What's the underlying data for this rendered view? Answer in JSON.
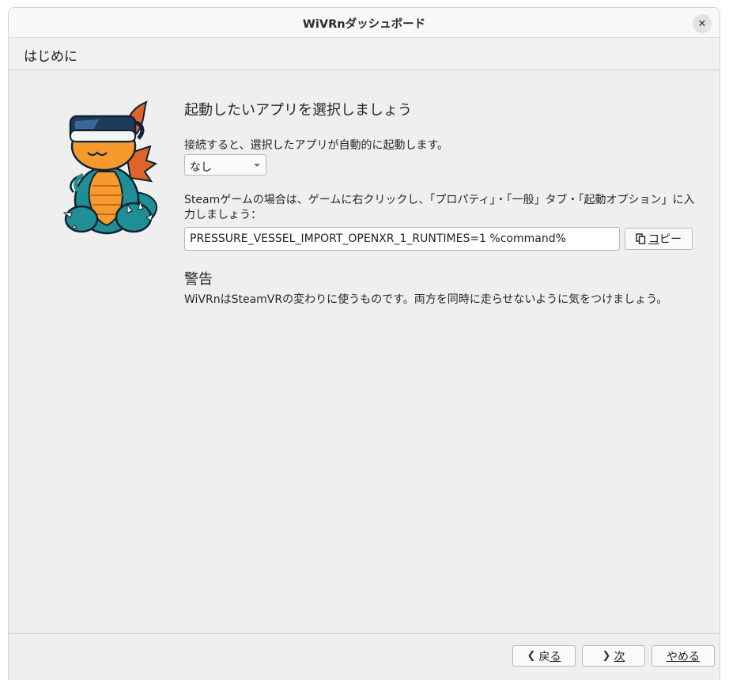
{
  "window": {
    "title": "WiVRnダッシュボード"
  },
  "header": {
    "page_title": "はじめに"
  },
  "main": {
    "heading": "起動したいアプリを選択しましょう",
    "description": "接続すると、選択したアプリが自動的に起動します。",
    "app_select": {
      "selected": "なし"
    },
    "steam_instructions": "Steamゲームの場合は、ゲームに右クリックし、「プロパティ」・「一般」タブ・「起動オプション」に入力しましょう：",
    "launch_command": "PRESSURE_VESSEL_IMPORT_OPENXR_1_RUNTIMES=1 %command%",
    "copy_button": {
      "icon": "copy-icon",
      "label_prefix": "コ",
      "label_rest": "ピー"
    },
    "warning": {
      "title": "警告",
      "text": "WiVRnはSteamVRの変わりに使うものです。両方を同時に走らせないように気をつけましょう。"
    }
  },
  "footer": {
    "back": {
      "label_prefix": "戻",
      "label_underlined": "る"
    },
    "next": {
      "label_underlined": "次"
    },
    "cancel": {
      "label": "やめる"
    }
  },
  "colors": {
    "window_bg": "#efeff0",
    "mascot_teal": "#1f8f95",
    "mascot_orange": "#f59a2c",
    "headset_navy": "#1f3a5a"
  }
}
